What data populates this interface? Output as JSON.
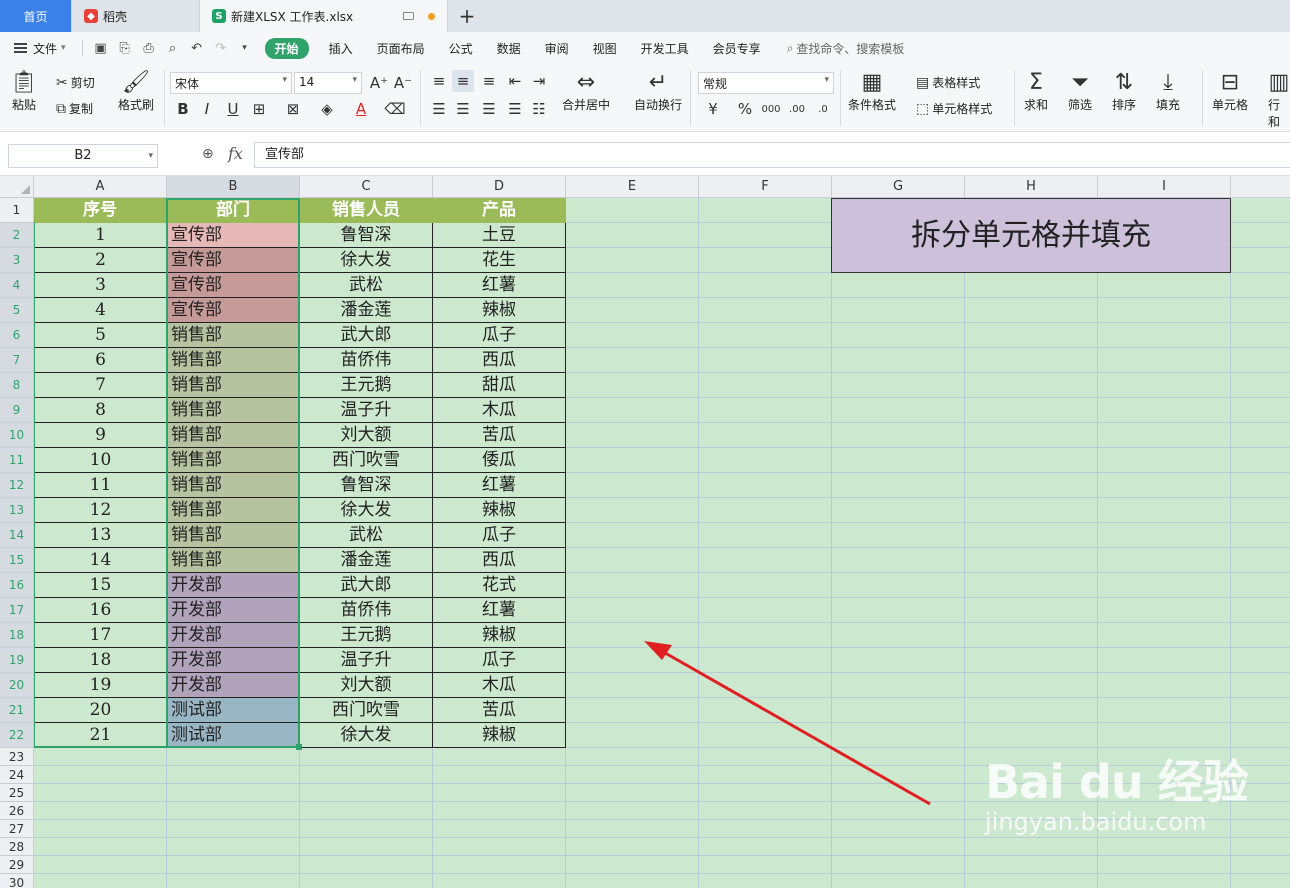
{
  "tabs": [
    {
      "label": "首页"
    },
    {
      "label": "稻壳"
    },
    {
      "label": "新建XLSX 工作表.xlsx"
    }
  ],
  "menu": {
    "file": "文件",
    "items": [
      "开始",
      "插入",
      "页面布局",
      "公式",
      "数据",
      "审阅",
      "视图",
      "开发工具",
      "会员专享"
    ],
    "search": "查找命令、搜索模板"
  },
  "ribbon": {
    "paste": "粘贴",
    "cut": "剪切",
    "copy": "复制",
    "format_painter": "格式刷",
    "font_name": "宋体",
    "font_size": "14",
    "merge_center": "合并居中",
    "wrap_text": "自动换行",
    "number_format": "常规",
    "cond_format": "条件格式",
    "table_style": "表格样式",
    "cell_style": "单元格样式",
    "sum": "求和",
    "filter": "筛选",
    "sort": "排序",
    "fill": "填充",
    "cell": "单元格",
    "row_col": "行和"
  },
  "formula_bar": {
    "name_box": "B2",
    "fx": "fx",
    "content": "宣传部"
  },
  "columns": [
    "A",
    "B",
    "C",
    "D",
    "E",
    "F",
    "G",
    "H",
    "I"
  ],
  "rows": [
    "1",
    "2",
    "3",
    "4",
    "5",
    "6",
    "7",
    "8",
    "9",
    "10",
    "11",
    "12",
    "13",
    "14",
    "15",
    "16",
    "17",
    "18",
    "19",
    "20",
    "21",
    "22",
    "23",
    "24",
    "25",
    "26",
    "27",
    "28",
    "29",
    "30"
  ],
  "table": {
    "headers": [
      "序号",
      "部门",
      "销售人员",
      "产品"
    ],
    "rows": [
      [
        "1",
        "宣传部",
        "鲁智深",
        "土豆"
      ],
      [
        "2",
        "宣传部",
        "徐大发",
        "花生"
      ],
      [
        "3",
        "宣传部",
        "武松",
        "红薯"
      ],
      [
        "4",
        "宣传部",
        "潘金莲",
        "辣椒"
      ],
      [
        "5",
        "销售部",
        "武大郎",
        "瓜子"
      ],
      [
        "6",
        "销售部",
        "苗侨伟",
        "西瓜"
      ],
      [
        "7",
        "销售部",
        "王元鹅",
        "甜瓜"
      ],
      [
        "8",
        "销售部",
        "温子升",
        "木瓜"
      ],
      [
        "9",
        "销售部",
        "刘大额",
        "苦瓜"
      ],
      [
        "10",
        "销售部",
        "西门吹雪",
        "倭瓜"
      ],
      [
        "11",
        "销售部",
        "鲁智深",
        "红薯"
      ],
      [
        "12",
        "销售部",
        "徐大发",
        "辣椒"
      ],
      [
        "13",
        "销售部",
        "武松",
        "瓜子"
      ],
      [
        "14",
        "销售部",
        "潘金莲",
        "西瓜"
      ],
      [
        "15",
        "开发部",
        "武大郎",
        "花式"
      ],
      [
        "16",
        "开发部",
        "苗侨伟",
        "红薯"
      ],
      [
        "17",
        "开发部",
        "王元鹅",
        "辣椒"
      ],
      [
        "18",
        "开发部",
        "温子升",
        "瓜子"
      ],
      [
        "19",
        "开发部",
        "刘大额",
        "木瓜"
      ],
      [
        "20",
        "测试部",
        "西门吹雪",
        "苦瓜"
      ],
      [
        "21",
        "测试部",
        "徐大发",
        "辣椒"
      ]
    ]
  },
  "dept_colors": {
    "宣传部": "#c59a98",
    "宣传部_first": "#e6b8b7",
    "销售部": "#b6c2a0",
    "开发部": "#b0a3bb",
    "测试部": "#98b6c4"
  },
  "title_box": "拆分单元格并填充",
  "watermark": {
    "main": "Bai du 经验",
    "sub": "jingyan.baidu.com"
  },
  "colors": {
    "accent": "#2fa36b",
    "sheet_bg": "#cce8cf",
    "header_green": "#9bbb59",
    "arrow": "#e02020"
  }
}
